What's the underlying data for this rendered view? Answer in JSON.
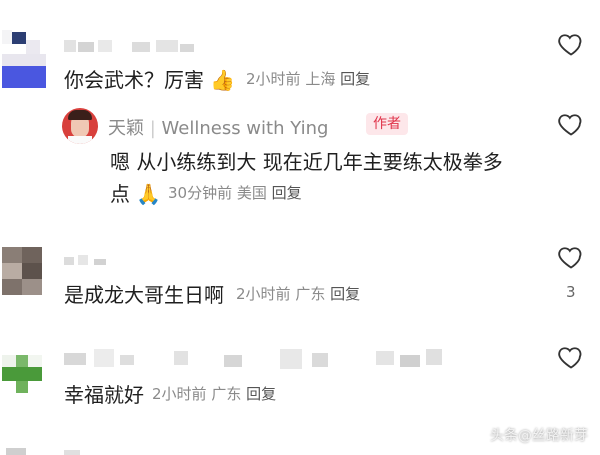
{
  "comments": [
    {
      "text": "你会武术？厉害",
      "emoji": "👍",
      "time": "2小时前",
      "location": "上海",
      "reply_label": "回复"
    },
    {
      "author_name": "天颖",
      "author_channel": "Wellness with Ying",
      "author_tag": "作者",
      "text_line1": "嗯 从小练练到大 现在近几年主要练太极拳多",
      "text_line2": "点",
      "emoji": "🙏",
      "time": "30分钟前",
      "location": "美国",
      "reply_label": "回复"
    },
    {
      "text": "是成龙大哥生日啊",
      "time": "2小时前",
      "location": "广东",
      "reply_label": "回复",
      "like_count": "3"
    },
    {
      "text": "幸福就好",
      "time": "2小时前",
      "location": "广东",
      "reply_label": "回复"
    }
  ],
  "watermark": "头条@丝路新芽",
  "icons": {
    "like": "heart-outline-icon"
  }
}
